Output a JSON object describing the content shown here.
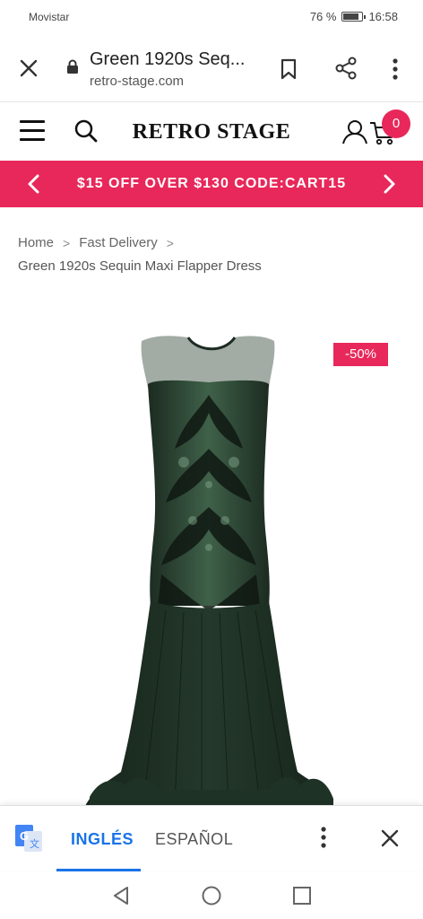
{
  "status": {
    "carrier": "Movistar",
    "battery": "76 %",
    "time": "16:58"
  },
  "browser": {
    "page_title": "Green 1920s Seq...",
    "url": "retro-stage.com"
  },
  "site": {
    "logo": "RETRO STAGE",
    "cart_count": "0"
  },
  "promo": {
    "text": "$15 OFF OVER $130 CODE:CART15"
  },
  "breadcrumb": {
    "home": "Home",
    "category": "Fast Delivery",
    "sep": ">",
    "current": "Green 1920s Sequin Maxi Flapper Dress"
  },
  "product": {
    "discount_badge": "-50%"
  },
  "translate": {
    "lang_source": "INGLÉS",
    "lang_target": "ESPAÑOL"
  },
  "colors": {
    "brand_pink": "#e8285a",
    "google_blue": "#1a73e8",
    "dress_green": "#1d2c22"
  },
  "icons": {
    "close": "close-icon",
    "lock": "lock-icon",
    "bookmark": "bookmark-icon",
    "share": "share-icon",
    "menu": "more-vert-icon",
    "hamburger": "hamburger-icon",
    "search": "search-icon",
    "account": "user-icon",
    "cart": "cart-icon",
    "translate": "google-translate-icon"
  }
}
